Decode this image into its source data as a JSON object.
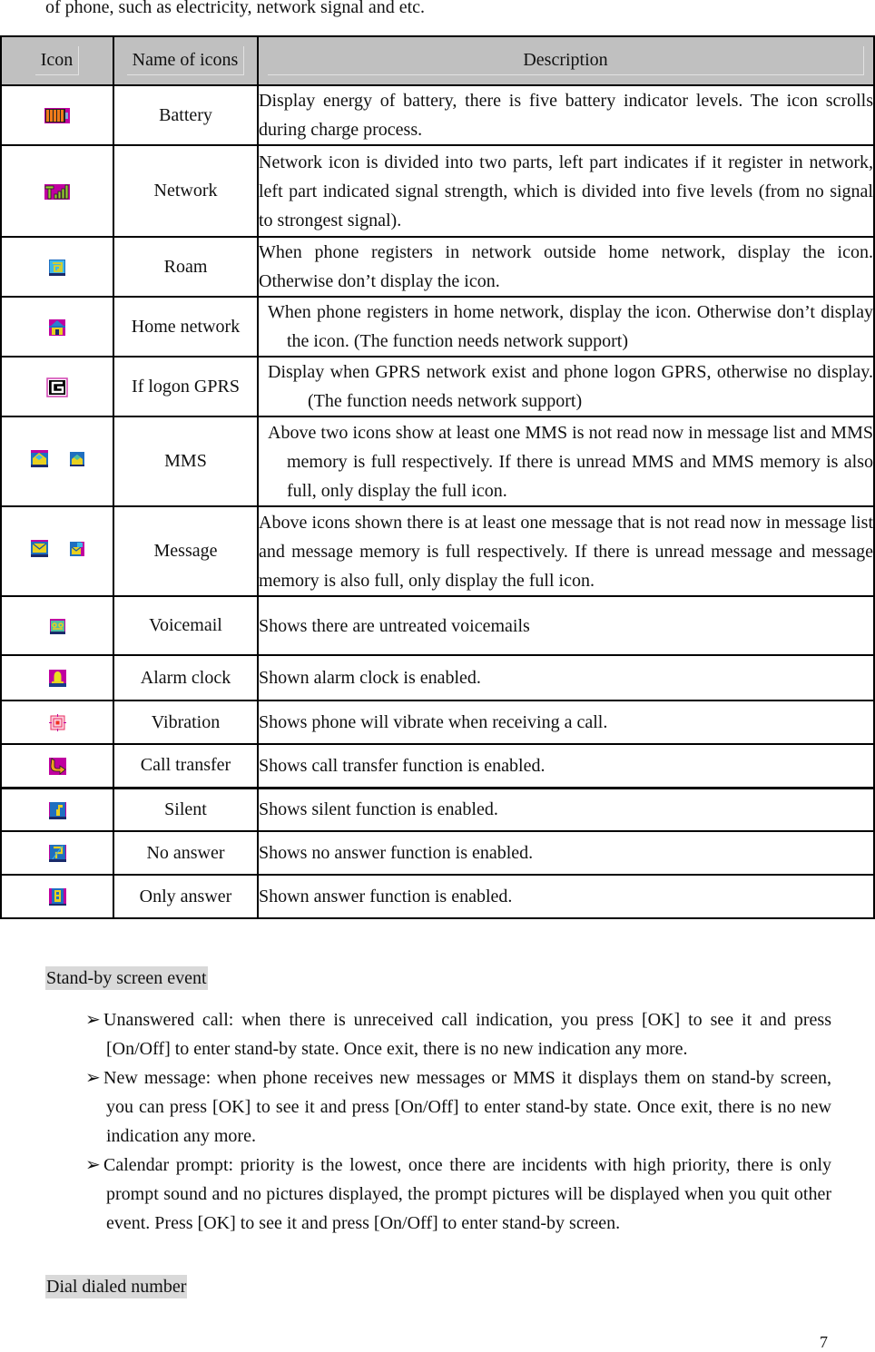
{
  "intro_text": "of phone, such as electricity, network signal and etc.",
  "table": {
    "headers": {
      "icon": "Icon",
      "name": "Name of icons",
      "description": "Description"
    },
    "rows": [
      {
        "icons": [
          "battery-icon"
        ],
        "name": "Battery",
        "description": "Display energy of battery, there is five battery indicator levels. The icon scrolls during charge process."
      },
      {
        "icons": [
          "network-signal-icon"
        ],
        "name": "Network",
        "description": "Network icon is divided into two parts, left part indicates if it register in network, left part indicated signal strength, which is divided into five levels (from no signal to strongest signal)."
      },
      {
        "icons": [
          "roam-icon"
        ],
        "name": "Roam",
        "description": "When phone registers in network outside home network, display the icon. Otherwise don’t display the icon."
      },
      {
        "icons": [
          "home-network-icon"
        ],
        "name": "Home network",
        "description": "When phone registers in home network, display the icon. Otherwise don’t display the icon. (The function needs network support)"
      },
      {
        "icons": [
          "gprs-icon"
        ],
        "name": "If logon GPRS",
        "description": "Display when GPRS network exist and phone logon GPRS, otherwise no display. (The function needs network support)"
      },
      {
        "icons": [
          "mms-unread-icon",
          "mms-full-icon"
        ],
        "name": "MMS",
        "description": "Above two icons show at least one MMS is not read now in message list and MMS memory is full respectively. If there is unread MMS and MMS memory is also full, only display the full icon."
      },
      {
        "icons": [
          "message-unread-icon",
          "message-full-icon"
        ],
        "name": "Message",
        "description": "Above icons shown there is at least one message that is not read now in message list and message memory is full respectively. If there is unread message and message memory is also full, only display the full icon."
      },
      {
        "icons": [
          "voicemail-icon"
        ],
        "name": "Voicemail",
        "description": "Shows there are untreated voicemails"
      },
      {
        "icons": [
          "alarm-clock-icon"
        ],
        "name": "Alarm clock",
        "description": "Shown alarm clock is enabled."
      },
      {
        "icons": [
          "vibration-icon"
        ],
        "name": "Vibration",
        "description": "Shows phone will vibrate when receiving a call."
      },
      {
        "icons": [
          "call-transfer-icon"
        ],
        "name": "Call transfer",
        "description": "Shows call transfer function is enabled."
      },
      {
        "icons": [
          "silent-icon"
        ],
        "name": "Silent",
        "description": "Shows silent function is enabled."
      },
      {
        "icons": [
          "no-answer-icon"
        ],
        "name": "No answer",
        "description": "Shows no answer function is enabled."
      },
      {
        "icons": [
          "only-answer-icon"
        ],
        "name": "Only answer",
        "description": "Shown answer function is enabled."
      }
    ]
  },
  "standby_section": {
    "heading": "Stand-by screen event",
    "bullet_glyph": "➢",
    "bullets": [
      "Unanswered call: when there is unreceived call indication, you press [OK] to see it and press [On/Off] to enter stand-by state. Once exit, there is no new indication any more.",
      "New message: when phone receives new messages or MMS it displays them on stand-by screen, you can press [OK] to see it and press [On/Off] to enter stand-by state. Once exit, there is no new indication any more.",
      "Calendar prompt: priority is the lowest, once there are incidents with high priority, there is only prompt sound and no pictures displayed, the prompt pictures will be displayed when you quit other event. Press [OK] to see it and press [On/Off] to enter stand-by screen."
    ]
  },
  "dial_section": {
    "heading": "Dial dialed number"
  },
  "page_number": "7"
}
